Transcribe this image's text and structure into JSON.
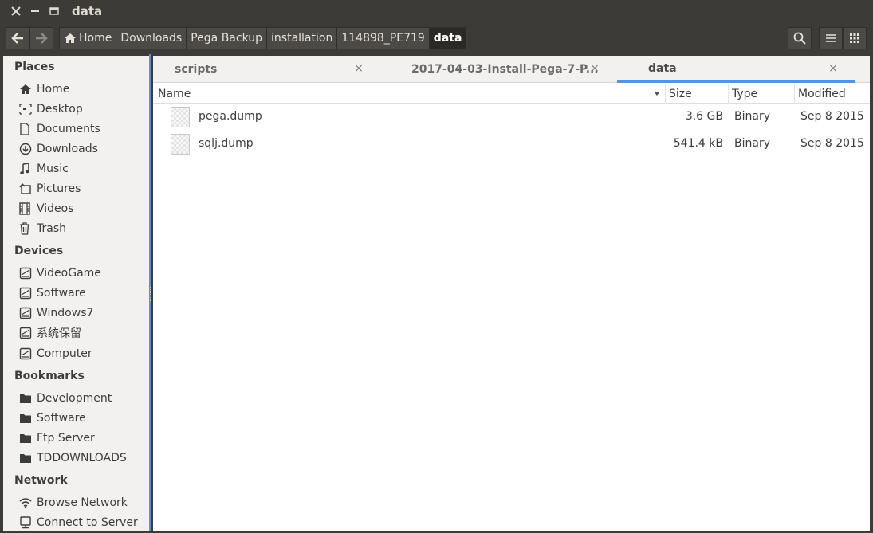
{
  "window": {
    "title": "data",
    "close_glyph": "✕",
    "minimize_glyph": "—"
  },
  "breadcrumbs": [
    {
      "label": "Home",
      "icon": "home-icon"
    },
    {
      "label": "Downloads"
    },
    {
      "label": "Pega Backup"
    },
    {
      "label": "installation"
    },
    {
      "label": "114898_PE719"
    },
    {
      "label": "data",
      "active": true
    }
  ],
  "sidebar": {
    "places": {
      "heading": "Places",
      "items": [
        {
          "label": "Home",
          "icon": "home-icon"
        },
        {
          "label": "Desktop",
          "icon": "desktop-icon"
        },
        {
          "label": "Documents",
          "icon": "document-icon"
        },
        {
          "label": "Downloads",
          "icon": "download-icon"
        },
        {
          "label": "Music",
          "icon": "music-icon"
        },
        {
          "label": "Pictures",
          "icon": "pictures-icon"
        },
        {
          "label": "Videos",
          "icon": "video-icon"
        },
        {
          "label": "Trash",
          "icon": "trash-icon"
        }
      ]
    },
    "devices": {
      "heading": "Devices",
      "items": [
        {
          "label": "VideoGame",
          "icon": "drive-icon"
        },
        {
          "label": "Software",
          "icon": "drive-icon"
        },
        {
          "label": "Windows7",
          "icon": "drive-icon"
        },
        {
          "label": "系统保留",
          "icon": "drive-icon"
        },
        {
          "label": "Computer",
          "icon": "drive-icon"
        }
      ]
    },
    "bookmarks": {
      "heading": "Bookmarks",
      "items": [
        {
          "label": "Development",
          "icon": "folder-icon"
        },
        {
          "label": "Software",
          "icon": "folder-icon"
        },
        {
          "label": "Ftp Server",
          "icon": "folder-icon"
        },
        {
          "label": "TDDOWNLOADS",
          "icon": "folder-icon"
        }
      ]
    },
    "network": {
      "heading": "Network",
      "items": [
        {
          "label": "Browse Network",
          "icon": "wifi-icon"
        },
        {
          "label": "Connect to Server",
          "icon": "server-icon"
        }
      ]
    }
  },
  "tabs": [
    {
      "label": "scripts",
      "close": "×"
    },
    {
      "label": "2017-04-03-Install-Pega-7-P...",
      "close": "×"
    },
    {
      "label": "data",
      "close": "×",
      "active": true
    }
  ],
  "columns": {
    "name": "Name",
    "size": "Size",
    "type": "Type",
    "modified": "Modified"
  },
  "files": [
    {
      "name": "pega.dump",
      "size": "3.6 GB",
      "type": "Binary",
      "modified": "Sep 8 2015"
    },
    {
      "name": "sqlj.dump",
      "size": "541.4 kB",
      "type": "Binary",
      "modified": "Sep 8 2015"
    }
  ],
  "colors": {
    "accent": "#5294e2",
    "toolbar_bg": "#3c3b37",
    "sidebar_bg": "#f2f1f0"
  }
}
